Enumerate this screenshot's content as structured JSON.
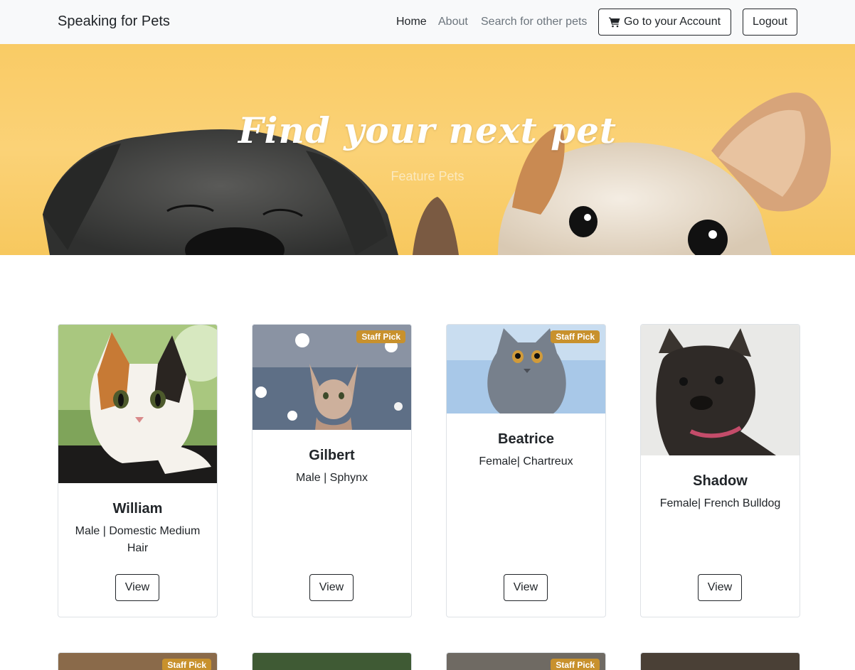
{
  "navbar": {
    "brand": "Speaking for Pets",
    "links": [
      {
        "label": "Home",
        "active": true
      },
      {
        "label": "About",
        "active": false
      },
      {
        "label": "Search for other pets",
        "active": false
      }
    ],
    "account_button": "Go to your Account",
    "account_icon": "cart-icon",
    "logout_button": "Logout"
  },
  "hero": {
    "title": "Find your next pet",
    "subtitle": "Feature Pets",
    "background_color": "#f9cb65"
  },
  "cards": [
    {
      "name": "William",
      "meta": "Male | Domestic Medium Hair",
      "badge": "",
      "view_label": "View"
    },
    {
      "name": "Gilbert",
      "meta": "Male | Sphynx",
      "badge": "Staff Pick",
      "view_label": "View"
    },
    {
      "name": "Beatrice",
      "meta": "Female| Chartreux",
      "badge": "Staff Pick",
      "view_label": "View"
    },
    {
      "name": "Shadow",
      "meta": "Female| French Bulldog",
      "badge": "",
      "view_label": "View"
    }
  ],
  "second_row_cards": [
    {
      "badge": "Staff Pick"
    },
    {
      "badge": ""
    },
    {
      "badge": "Staff Pick"
    },
    {
      "badge": ""
    }
  ],
  "colors": {
    "badge": "#c8912d",
    "navbar_bg": "#f8f9fa",
    "text": "#212529",
    "muted": "#6c757d"
  }
}
